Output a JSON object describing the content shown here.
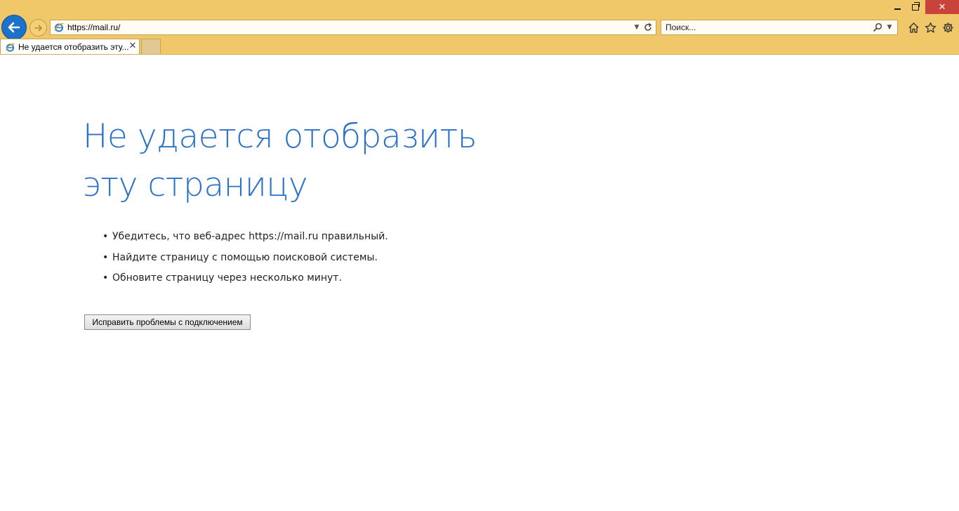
{
  "window": {
    "minimize_label": "",
    "restore_label": "",
    "close_label": "✕"
  },
  "address_bar": {
    "url": "https://mail.ru/"
  },
  "search_bar": {
    "placeholder": "Поиск..."
  },
  "tabs": [
    {
      "title": "Не удается отобразить эту..."
    }
  ],
  "content": {
    "title": "Не удается отобразить эту страницу",
    "suggestions": [
      "Убедитесь, что веб-адрес https://mail.ru правильный.",
      "Найдите страницу с помощью поисковой системы.",
      "Обновите страницу через несколько минут."
    ],
    "fix_button_label": "Исправить проблемы с подключением"
  },
  "colors": {
    "chrome_background": "#f0c86a",
    "title_blue": "#2a72c9",
    "back_button": "#1a73c9",
    "close_button": "#c9433c"
  },
  "icons": {
    "back": "arrow-left-icon",
    "forward": "arrow-right-icon",
    "page": "internet-explorer-icon",
    "refresh": "refresh-icon",
    "search": "magnifier-icon",
    "home": "home-icon",
    "favorites": "star-icon",
    "tools": "gear-icon"
  }
}
